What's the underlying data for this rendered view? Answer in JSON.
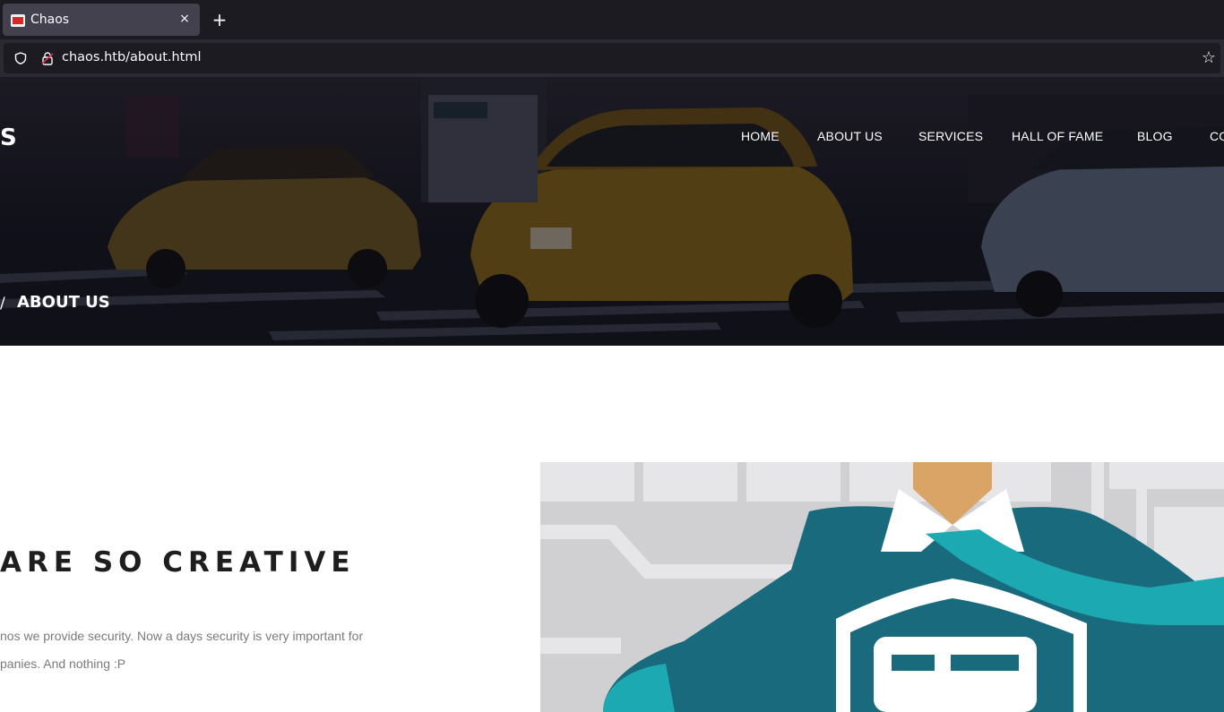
{
  "browser": {
    "tab_title": "Chaos",
    "close_glyph": "×",
    "new_tab_glyph": "+",
    "url": "chaos.htb/about.html",
    "bookmark_glyph": "☆"
  },
  "site": {
    "brand_partial": "S",
    "nav": [
      "HOME",
      "ABOUT US",
      "SERVICES",
      "HALL OF FAME",
      "BLOG",
      "CO"
    ],
    "breadcrumb_separator": "/",
    "breadcrumb_current": "ABOUT US"
  },
  "content": {
    "heading": "ARE SO CREATIVE",
    "paragraph_line1": "nos we provide security. Now a days security is very important for",
    "paragraph_line2": "panies. And nothing :P"
  },
  "colors": {
    "accent_teal": "#1a6a7d",
    "accent_cyan": "#1ca9b2",
    "skin": "#d9a466"
  }
}
